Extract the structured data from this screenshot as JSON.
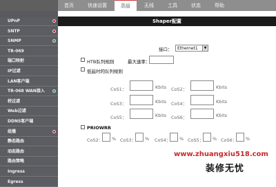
{
  "topnav": {
    "tabs": [
      "首页",
      "快速设置",
      "高级",
      "无线",
      "工具",
      "状态",
      "帮助"
    ],
    "active_index": 2
  },
  "sidebar": {
    "items": [
      {
        "label": "UPnP",
        "dot": "red"
      },
      {
        "label": "SNTP",
        "dot": "red"
      },
      {
        "label": "SNMP",
        "dot": "green"
      },
      {
        "label": "TR-069",
        "dot": ""
      },
      {
        "label": "端口映射",
        "dot": ""
      },
      {
        "label": "IP过滤",
        "dot": ""
      },
      {
        "label": "LAN客户端",
        "dot": ""
      },
      {
        "label": "TR-068 WAN接入",
        "dot": "green"
      },
      {
        "label": "桥过滤",
        "dot": ""
      },
      {
        "label": "Web过滤",
        "dot": ""
      },
      {
        "label": "DDNS客户端",
        "dot": ""
      },
      {
        "label": "组播",
        "dot": "red"
      },
      {
        "label": "静态路由",
        "dot": ""
      },
      {
        "label": "动态路由",
        "dot": ""
      },
      {
        "label": "路由策略",
        "dot": ""
      },
      {
        "label": "Ingress",
        "dot": ""
      },
      {
        "label": "Egress",
        "dot": ""
      }
    ],
    "dot_colors": {
      "red": "#cc2222",
      "green": "#2e9e3e"
    }
  },
  "main": {
    "title": "Shaper配置",
    "interface_label": "接口：",
    "interface_value": "Ethernet1",
    "htb_label": "HTB队列规则",
    "max_rate_label": "最大速率：",
    "max_rate_value": "",
    "low_latency_label": "低延时的队列规则",
    "cos_rows": [
      {
        "l1": "CoS1：",
        "l2": "CoS2："
      },
      {
        "l1": "CoS3：",
        "l2": "CoS4："
      },
      {
        "l1": "CoS5：",
        "l2": "CoS6："
      }
    ],
    "unit": "Kbits",
    "priowrr_label": "PRIOWRR",
    "prio_items": [
      "CoS2：",
      "CoS3：",
      "CoS4：",
      "CoS5：",
      "CoS6："
    ],
    "percent": "%"
  },
  "watermark": {
    "url": "www.zhuangxiu518.com",
    "brand": "装修无忧"
  }
}
